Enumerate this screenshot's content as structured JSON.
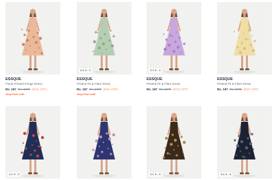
{
  "products": [
    {
      "brand": "ESSQUE",
      "description": "Floral Printed Fringe Dress",
      "price": "Rs. 197",
      "mrp": "Rs. 1975",
      "discount": "(90% OFF)",
      "stock_note": "Only Few Left!",
      "rating": null,
      "rating_count": null,
      "dress_color": "#e9b99a",
      "dress_pattern": "#c98a6a"
    },
    {
      "brand": "ESSQUE",
      "description": "Printed Fit & Flare Dress",
      "price": "Rs. 197",
      "mrp": "Rs. 1975",
      "discount": "(90% OFF)",
      "stock_note": "Only Few Left!",
      "rating": "4.6",
      "rating_count": "5",
      "dress_color": "#b5cdb3",
      "dress_pattern": "#8fae8c"
    },
    {
      "brand": "ESSQUE",
      "description": "Printed Fit & Flare Dress",
      "price": "Rs. 197",
      "mrp": "Rs. 1975",
      "discount": "(90% OFF)",
      "stock_note": "",
      "rating": "3.3",
      "rating_count": "4",
      "dress_color": "#c8a6de",
      "dress_pattern": "#a884c2"
    },
    {
      "brand": "ESSQUE",
      "description": "Printed Fit & Flare Dress",
      "price": "Rs. 197",
      "mrp": "Rs. 1975",
      "discount": "(90% OFF)",
      "stock_note": "",
      "rating": null,
      "rating_count": null,
      "dress_color": "#efdfa6",
      "dress_pattern": "#d8c27e"
    },
    {
      "brand": "",
      "description": "",
      "rating": "4.0",
      "rating_count": "9",
      "dress_color": "#1f2f57",
      "dress_pattern": "#c3453b"
    },
    {
      "brand": "",
      "description": "",
      "rating": null,
      "rating_count": null,
      "dress_color": "#2d3672",
      "dress_pattern": "#c58fb8"
    },
    {
      "brand": "",
      "description": "",
      "rating": "3.4",
      "rating_count": "5",
      "dress_color": "#3a2a1c",
      "dress_pattern": "#b58a48"
    },
    {
      "brand": "",
      "description": "",
      "rating": "3.6",
      "rating_count": "6",
      "dress_color": "#1b2333",
      "dress_pattern": "#5a6378"
    }
  ]
}
